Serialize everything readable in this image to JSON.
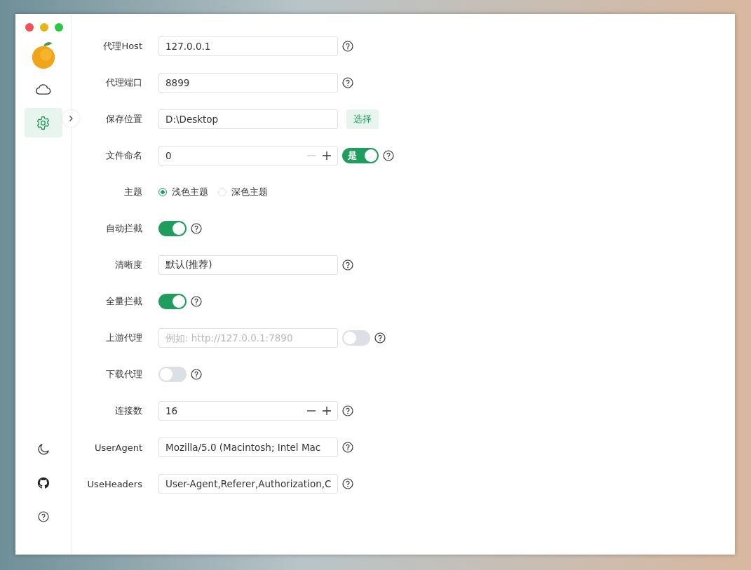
{
  "sidebar": {
    "nav": [
      {
        "kind": "cloud",
        "selected": false
      },
      {
        "kind": "gear",
        "selected": true
      }
    ],
    "bottom": [
      {
        "kind": "moon"
      },
      {
        "kind": "cat"
      },
      {
        "kind": "help"
      }
    ]
  },
  "settings": [
    {
      "label": "代理Host",
      "kind": "text",
      "value": "127.0.0.1",
      "help": true
    },
    {
      "label": "代理端口",
      "kind": "text",
      "value": "8899",
      "help": true
    },
    {
      "label": "保存位置",
      "kind": "folder",
      "value": "D:\\Desktop",
      "button": "选择",
      "help": false
    },
    {
      "label": "文件命名",
      "kind": "number",
      "value": "0",
      "minus_disabled": true,
      "toggle": {
        "on": true,
        "text": "是"
      },
      "help": true
    },
    {
      "label": "主题",
      "kind": "radio",
      "options": [
        {
          "label": "浅色主题",
          "selected": true
        },
        {
          "label": "深色主题",
          "selected": false
        }
      ],
      "help": false
    },
    {
      "label": "自动拦截",
      "kind": "switch",
      "on": true,
      "help": true
    },
    {
      "label": "清晰度",
      "kind": "select",
      "value": "默认(推荐)",
      "help": true
    },
    {
      "label": "全量拦截",
      "kind": "switch",
      "on": true,
      "help": true
    },
    {
      "label": "上游代理",
      "kind": "text",
      "placeholder": "例如: http://127.0.0.1:7890",
      "toggle": {
        "on": false
      },
      "help": true
    },
    {
      "label": "下载代理",
      "kind": "switch",
      "on": false,
      "help": true
    },
    {
      "label": "连接数",
      "kind": "number",
      "value": "16",
      "minus_disabled": false,
      "help": true
    },
    {
      "label": "UserAgent",
      "kind": "text",
      "value": "Mozilla/5.0 (Macintosh; Intel Mac",
      "help": true
    },
    {
      "label": "UseHeaders",
      "kind": "text",
      "value": "User-Agent,Referer,Authorization,C",
      "help": true
    }
  ]
}
